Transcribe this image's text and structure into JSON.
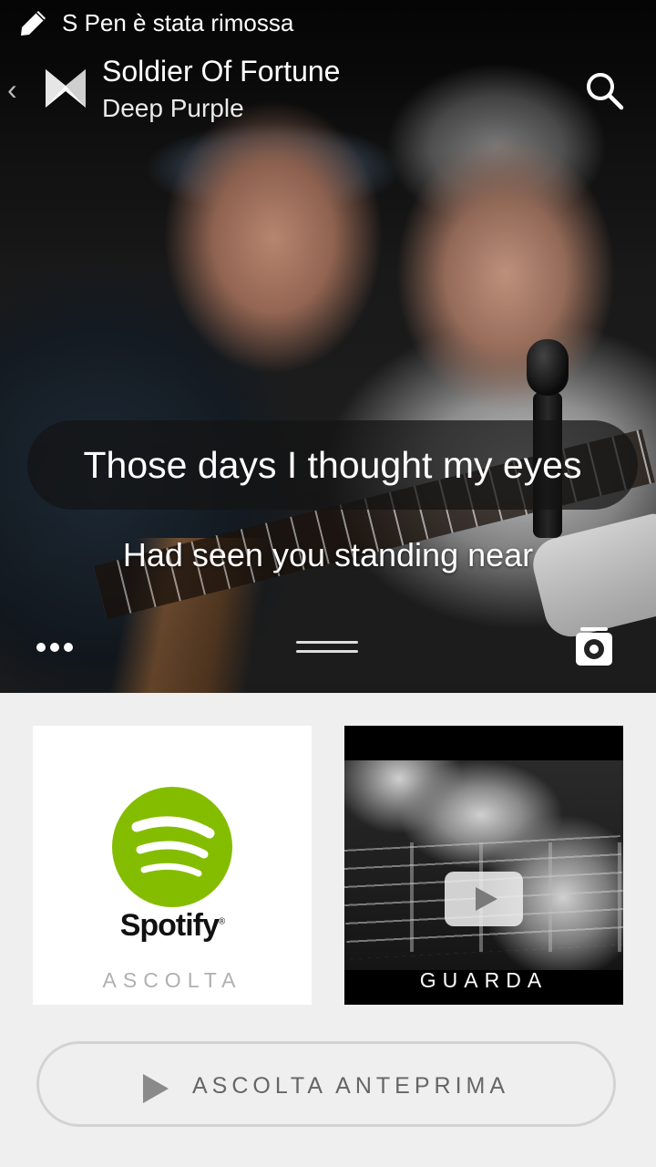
{
  "status_bar": {
    "text": "S Pen è stata rimossa",
    "icon": "pen-icon"
  },
  "header": {
    "title": "Soldier Of Fortune",
    "artist": "Deep Purple",
    "back_icon": "chevron-left-icon",
    "logo_icon": "musixmatch-logo-icon",
    "search_icon": "search-icon"
  },
  "lyrics": {
    "current": "Those days I thought my eyes",
    "next": "Had seen you standing near"
  },
  "hero_controls": {
    "more_icon": "more-dots-icon",
    "handle_icon": "drag-handle-icon",
    "camera_icon": "camera-icon"
  },
  "cards": {
    "spotify": {
      "brand": "Spotify",
      "label": "ASCOLTA",
      "color": "#84bd00"
    },
    "video": {
      "label": "GUARDA",
      "icon": "play-icon"
    }
  },
  "preview_button": {
    "label": "ASCOLTA ANTEPRIMA",
    "icon": "play-triangle-icon"
  }
}
